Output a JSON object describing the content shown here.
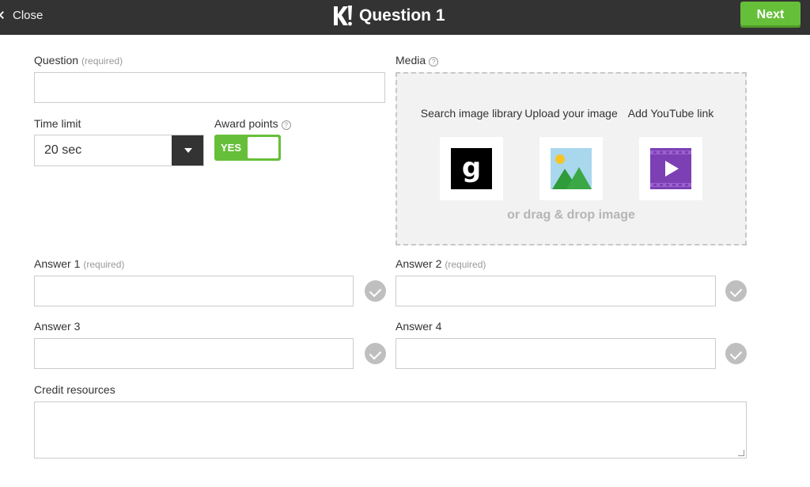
{
  "header": {
    "close_label": "Close",
    "logo_text": "K!",
    "title": "Question 1",
    "next_label": "Next"
  },
  "question": {
    "label": "Question",
    "required": "(required)",
    "value": ""
  },
  "time_limit": {
    "label": "Time limit",
    "selected": "20 sec"
  },
  "award_points": {
    "label": "Award points",
    "toggle_text": "YES",
    "enabled": true
  },
  "media": {
    "label": "Media",
    "options": [
      {
        "label": "Search image library",
        "icon": "getty-g-icon"
      },
      {
        "label": "Upload your image",
        "icon": "image-upload-icon"
      },
      {
        "label": "Add YouTube link",
        "icon": "video-play-icon"
      }
    ],
    "drag_text": "or drag & drop image"
  },
  "answers": [
    {
      "label": "Answer 1",
      "required": "(required)",
      "value": "",
      "correct": false
    },
    {
      "label": "Answer 2",
      "required": "(required)",
      "value": "",
      "correct": false
    },
    {
      "label": "Answer 3",
      "required": "",
      "value": "",
      "correct": false
    },
    {
      "label": "Answer 4",
      "required": "",
      "value": "",
      "correct": false
    }
  ],
  "credit": {
    "label": "Credit resources",
    "value": ""
  },
  "colors": {
    "topbar": "#333333",
    "accent_green": "#66bf39",
    "media_bg": "#f2f2f2",
    "check_gray": "#bfbfbf"
  }
}
